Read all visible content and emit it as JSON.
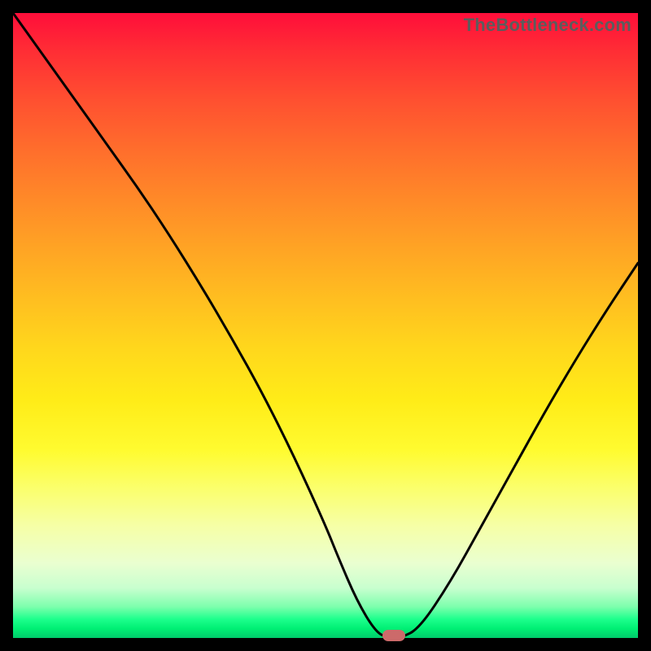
{
  "watermark": "TheBottleneck.com",
  "colors": {
    "frame": "#000000",
    "curve_stroke": "#000000",
    "marker_fill": "#cc6a6a"
  },
  "chart_data": {
    "type": "line",
    "title": "",
    "xlabel": "",
    "ylabel": "",
    "xlim": [
      0,
      100
    ],
    "ylim": [
      0,
      100
    ],
    "grid": false,
    "series": [
      {
        "name": "bottleneck-curve",
        "x": [
          0,
          5,
          10,
          15,
          20,
          25,
          30,
          35,
          40,
          45,
          50,
          52,
          55,
          58,
          60,
          62,
          65,
          70,
          75,
          80,
          85,
          90,
          95,
          100
        ],
        "y": [
          100,
          93,
          86,
          79,
          72,
          64.5,
          56.5,
          48,
          39,
          29,
          18,
          13,
          6,
          1,
          0,
          0,
          1.5,
          9,
          18,
          27,
          36,
          44.5,
          52.5,
          60
        ]
      }
    ],
    "marker": {
      "x": 61,
      "y": 0
    },
    "gradient_stops": [
      {
        "pct": 0,
        "color": "#ff0e3a"
      },
      {
        "pct": 6,
        "color": "#ff2d35"
      },
      {
        "pct": 14,
        "color": "#ff5030"
      },
      {
        "pct": 22,
        "color": "#ff6e2c"
      },
      {
        "pct": 30,
        "color": "#ff8a28"
      },
      {
        "pct": 38,
        "color": "#ffa524"
      },
      {
        "pct": 46,
        "color": "#ffbf20"
      },
      {
        "pct": 54,
        "color": "#ffd81c"
      },
      {
        "pct": 62,
        "color": "#ffec18"
      },
      {
        "pct": 70,
        "color": "#fffb30"
      },
      {
        "pct": 76,
        "color": "#fbff6c"
      },
      {
        "pct": 82,
        "color": "#f6ffa6"
      },
      {
        "pct": 88,
        "color": "#eaffd0"
      },
      {
        "pct": 92,
        "color": "#c8ffcf"
      },
      {
        "pct": 95,
        "color": "#7dffad"
      },
      {
        "pct": 97,
        "color": "#1cff8c"
      },
      {
        "pct": 98.5,
        "color": "#00ef74"
      },
      {
        "pct": 100,
        "color": "#00ca6b"
      }
    ]
  }
}
